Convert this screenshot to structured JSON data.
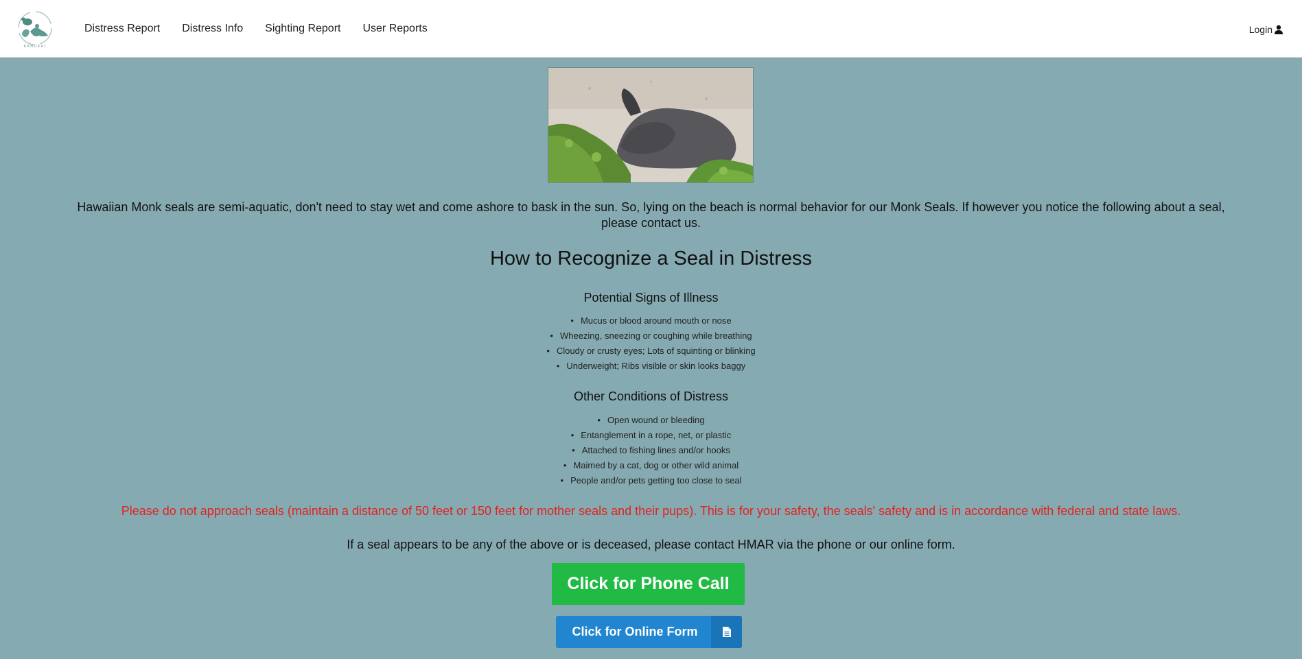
{
  "nav": {
    "logo_text": "KAHUKAI",
    "links": [
      "Distress Report",
      "Distress Info",
      "Sighting Report",
      "User Reports"
    ],
    "login_label": "Login"
  },
  "page": {
    "intro": "Hawaiian Monk seals are semi-aquatic, don't need to stay wet and come ashore to bask in the sun. So, lying on the beach is normal behavior for our Monk Seals. If however you notice the following about a seal, please contact us.",
    "title": "How to Recognize a Seal in Distress",
    "illness_heading": "Potential Signs of Illness",
    "illness_items": [
      "Mucus or blood around mouth or nose",
      "Wheezing, sneezing or coughing while breathing",
      "Cloudy or crusty eyes; Lots of squinting or blinking",
      "Underweight; Ribs visible or skin looks baggy"
    ],
    "distress_heading": "Other Conditions of Distress",
    "distress_items": [
      "Open wound or bleeding",
      "Entanglement in a rope, net, or plastic",
      "Attached to fishing lines and/or hooks",
      "Maimed by a cat, dog or other wild animal",
      "People and/or pets getting too close to seal"
    ],
    "warning": "Please do not approach seals (maintain a distance of 50 feet or 150 feet for mother seals and their pups). This is for your safety, the seals' safety and is in accordance with federal and state laws.",
    "contact": "If a seal appears to be any of the above or is deceased, please contact HMAR via the phone or our online form.",
    "phone_button": "Click for Phone Call",
    "form_button": "Click for Online Form"
  },
  "colors": {
    "background": "#86aab2",
    "warning": "#e0231f",
    "phone_button": "#21ba45",
    "form_button": "#2185d0"
  },
  "icons": {
    "login": "user-icon",
    "form": "file-icon"
  }
}
